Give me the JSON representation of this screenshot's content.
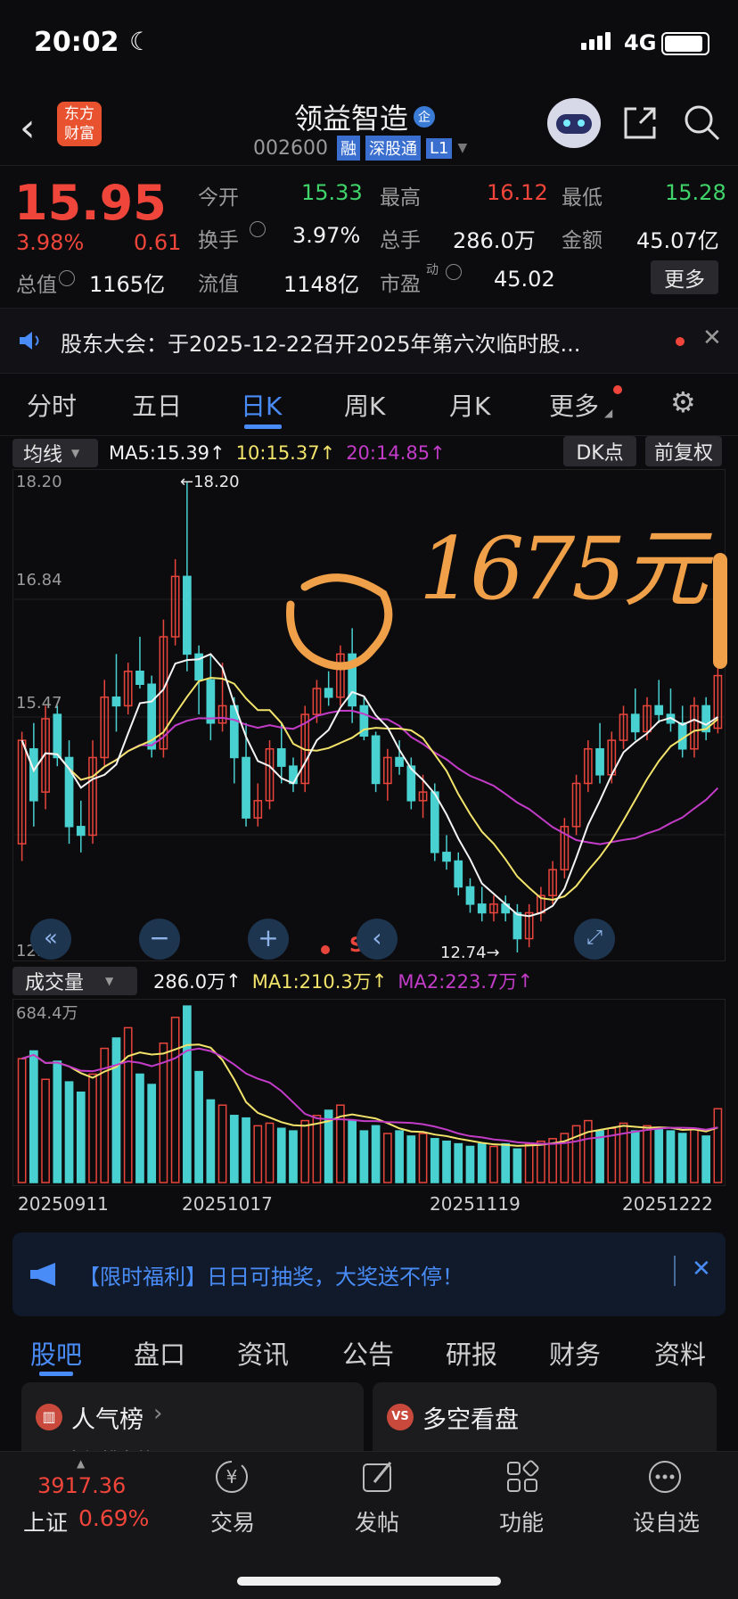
{
  "status": {
    "time": "20:02",
    "network": "4G"
  },
  "header": {
    "logo": "东方财富",
    "name": "领益智造",
    "name_badge": "企",
    "code": "002600",
    "tags": [
      "融",
      "深股通",
      "L1"
    ]
  },
  "quote": {
    "price": "15.95",
    "change_pct": "3.98%",
    "change": "0.61",
    "stats": [
      {
        "label": "今开",
        "value": "15.33",
        "color": "green"
      },
      {
        "label": "最高",
        "value": "16.12",
        "color": "red"
      },
      {
        "label": "最低",
        "value": "15.28",
        "color": "green"
      },
      {
        "label": "换手",
        "value": "3.97%",
        "color": "white"
      },
      {
        "label": "总手",
        "value": "286.0万",
        "color": "white"
      },
      {
        "label": "金额",
        "value": "45.07亿",
        "color": "white"
      },
      {
        "label": "总值",
        "value": "1165亿",
        "color": "white"
      },
      {
        "label": "流值",
        "value": "1148亿",
        "color": "white"
      },
      {
        "label": "市盈",
        "label_sup": "动",
        "value": "45.02",
        "color": "white"
      }
    ],
    "more_button": "更多"
  },
  "notice": {
    "text": "股东大会：于2025-12-22召开2025年第六次临时股..."
  },
  "chart_tabs": {
    "items": [
      "分时",
      "五日",
      "日K",
      "周K",
      "月K",
      "更多"
    ],
    "active_index": 2
  },
  "ma_bar": {
    "selector": "均线",
    "ma5": "MA5:15.39",
    "ma10": "10:15.37",
    "ma20": "20:14.85",
    "dk_button": "DK点",
    "adjust_button": "前复权"
  },
  "chart_data": {
    "type": "candlestick",
    "y_ticks": [
      "18.20",
      "16.84",
      "15.47",
      "12.74"
    ],
    "ylim": [
      12.74,
      18.2
    ],
    "high_label": "18.20",
    "low_label": "12.74",
    "annotation": "1675元",
    "volume": {
      "selector": "成交量",
      "current": "286.0万",
      "ma1": "MA1:210.3万",
      "ma2": "MA2:223.7万",
      "max_label": "684.4万"
    },
    "x_labels": [
      "20250911",
      "20251017",
      "20251119",
      "20251222"
    ],
    "candles": [
      {
        "o": 14.0,
        "h": 15.3,
        "l": 13.8,
        "c": 15.2
      },
      {
        "o": 15.1,
        "h": 15.4,
        "l": 14.2,
        "c": 14.5
      },
      {
        "o": 14.6,
        "h": 15.6,
        "l": 14.4,
        "c": 15.45
      },
      {
        "o": 15.5,
        "h": 15.6,
        "l": 14.9,
        "c": 15.0
      },
      {
        "o": 15.0,
        "h": 15.2,
        "l": 14.0,
        "c": 14.2
      },
      {
        "o": 14.2,
        "h": 14.5,
        "l": 13.9,
        "c": 14.1
      },
      {
        "o": 14.1,
        "h": 15.2,
        "l": 14.0,
        "c": 15.0
      },
      {
        "o": 15.0,
        "h": 15.9,
        "l": 14.9,
        "c": 15.7
      },
      {
        "o": 15.7,
        "h": 16.2,
        "l": 15.3,
        "c": 15.6
      },
      {
        "o": 15.6,
        "h": 16.1,
        "l": 15.5,
        "c": 16.0
      },
      {
        "o": 16.0,
        "h": 16.4,
        "l": 15.8,
        "c": 15.85
      },
      {
        "o": 15.85,
        "h": 15.95,
        "l": 15.0,
        "c": 15.1
      },
      {
        "o": 15.1,
        "h": 16.6,
        "l": 15.0,
        "c": 16.4
      },
      {
        "o": 16.4,
        "h": 17.3,
        "l": 16.3,
        "c": 17.1
      },
      {
        "o": 17.1,
        "h": 18.2,
        "l": 16.0,
        "c": 16.2
      },
      {
        "o": 16.2,
        "h": 16.3,
        "l": 15.5,
        "c": 15.9
      },
      {
        "o": 15.9,
        "h": 16.2,
        "l": 15.2,
        "c": 15.4
      },
      {
        "o": 15.4,
        "h": 16.1,
        "l": 15.3,
        "c": 15.6
      },
      {
        "o": 15.6,
        "h": 15.7,
        "l": 14.7,
        "c": 15.0
      },
      {
        "o": 15.0,
        "h": 15.4,
        "l": 14.2,
        "c": 14.3
      },
      {
        "o": 14.3,
        "h": 14.7,
        "l": 14.2,
        "c": 14.5
      },
      {
        "o": 14.5,
        "h": 15.2,
        "l": 14.4,
        "c": 15.1
      },
      {
        "o": 15.1,
        "h": 15.4,
        "l": 14.7,
        "c": 14.9
      },
      {
        "o": 14.9,
        "h": 15.0,
        "l": 14.6,
        "c": 14.7
      },
      {
        "o": 14.7,
        "h": 15.6,
        "l": 14.6,
        "c": 15.5
      },
      {
        "o": 15.5,
        "h": 15.9,
        "l": 15.4,
        "c": 15.8
      },
      {
        "o": 15.8,
        "h": 16.0,
        "l": 15.6,
        "c": 15.7
      },
      {
        "o": 15.7,
        "h": 16.3,
        "l": 15.6,
        "c": 16.2
      },
      {
        "o": 16.2,
        "h": 16.5,
        "l": 15.4,
        "c": 15.6
      },
      {
        "o": 15.6,
        "h": 15.7,
        "l": 15.2,
        "c": 15.25
      },
      {
        "o": 15.25,
        "h": 15.3,
        "l": 14.6,
        "c": 14.7
      },
      {
        "o": 14.7,
        "h": 15.1,
        "l": 14.5,
        "c": 15.0
      },
      {
        "o": 15.0,
        "h": 15.2,
        "l": 14.8,
        "c": 14.9
      },
      {
        "o": 14.9,
        "h": 15.0,
        "l": 14.4,
        "c": 14.5
      },
      {
        "o": 14.5,
        "h": 14.8,
        "l": 14.3,
        "c": 14.6
      },
      {
        "o": 14.6,
        "h": 14.7,
        "l": 13.8,
        "c": 13.9
      },
      {
        "o": 13.9,
        "h": 14.1,
        "l": 13.7,
        "c": 13.8
      },
      {
        "o": 13.8,
        "h": 13.9,
        "l": 13.4,
        "c": 13.5
      },
      {
        "o": 13.5,
        "h": 13.6,
        "l": 13.2,
        "c": 13.3
      },
      {
        "o": 13.3,
        "h": 13.5,
        "l": 13.1,
        "c": 13.2
      },
      {
        "o": 13.2,
        "h": 13.4,
        "l": 13.1,
        "c": 13.3
      },
      {
        "o": 13.3,
        "h": 13.4,
        "l": 13.1,
        "c": 13.2
      },
      {
        "o": 13.2,
        "h": 13.3,
        "l": 12.74,
        "c": 12.9
      },
      {
        "o": 12.9,
        "h": 13.3,
        "l": 12.8,
        "c": 13.2
      },
      {
        "o": 13.2,
        "h": 13.5,
        "l": 13.1,
        "c": 13.4
      },
      {
        "o": 13.4,
        "h": 13.8,
        "l": 13.3,
        "c": 13.7
      },
      {
        "o": 13.7,
        "h": 14.3,
        "l": 13.6,
        "c": 14.2
      },
      {
        "o": 14.2,
        "h": 14.8,
        "l": 14.1,
        "c": 14.7
      },
      {
        "o": 14.7,
        "h": 15.2,
        "l": 14.6,
        "c": 15.1
      },
      {
        "o": 15.1,
        "h": 15.4,
        "l": 14.7,
        "c": 14.8
      },
      {
        "o": 14.8,
        "h": 15.3,
        "l": 14.7,
        "c": 15.2
      },
      {
        "o": 15.2,
        "h": 15.6,
        "l": 15.1,
        "c": 15.5
      },
      {
        "o": 15.5,
        "h": 15.8,
        "l": 15.2,
        "c": 15.3
      },
      {
        "o": 15.3,
        "h": 15.7,
        "l": 15.2,
        "c": 15.6
      },
      {
        "o": 15.6,
        "h": 15.9,
        "l": 15.4,
        "c": 15.5
      },
      {
        "o": 15.5,
        "h": 15.8,
        "l": 15.3,
        "c": 15.4
      },
      {
        "o": 15.4,
        "h": 15.6,
        "l": 15.0,
        "c": 15.1
      },
      {
        "o": 15.1,
        "h": 15.7,
        "l": 15.0,
        "c": 15.6
      },
      {
        "o": 15.6,
        "h": 15.7,
        "l": 15.2,
        "c": 15.3
      },
      {
        "o": 15.34,
        "h": 16.12,
        "l": 15.28,
        "c": 15.95
      }
    ],
    "volumes": [
      480,
      510,
      400,
      470,
      390,
      350,
      420,
      520,
      560,
      600,
      420,
      380,
      540,
      640,
      684,
      430,
      320,
      300,
      260,
      250,
      220,
      230,
      210,
      200,
      240,
      260,
      280,
      300,
      240,
      200,
      220,
      190,
      200,
      180,
      190,
      170,
      160,
      150,
      140,
      150,
      140,
      150,
      130,
      150,
      160,
      170,
      190,
      220,
      240,
      200,
      210,
      230,
      200,
      220,
      210,
      200,
      190,
      210,
      180,
      286
    ],
    "colors": {
      "up": "#e8453c",
      "down": "#48d1d0",
      "ma5": "#f4f4f4",
      "ma10": "#f2e36b",
      "ma20": "#c23cc8"
    }
  },
  "promo": {
    "text": "【限时福利】日日可抽奖，大奖送不停！"
  },
  "info_tabs": {
    "items": [
      "股吧",
      "盘口",
      "资讯",
      "公告",
      "研报",
      "财务",
      "资料"
    ],
    "active_index": 0
  },
  "cards": [
    {
      "title": "人气榜",
      "sub": "A股市场排名第"
    },
    {
      "title": "多空看盘",
      "badge": "VS"
    }
  ],
  "bottom_nav": {
    "index_value": "3917.36",
    "index_name": "上证",
    "index_pct": "0.69%",
    "items": [
      {
        "label": "交易",
        "icon": "yuan-icon"
      },
      {
        "label": "发帖",
        "icon": "edit-icon"
      },
      {
        "label": "功能",
        "icon": "grid-icon"
      },
      {
        "label": "设自选",
        "icon": "more-icon"
      }
    ]
  }
}
